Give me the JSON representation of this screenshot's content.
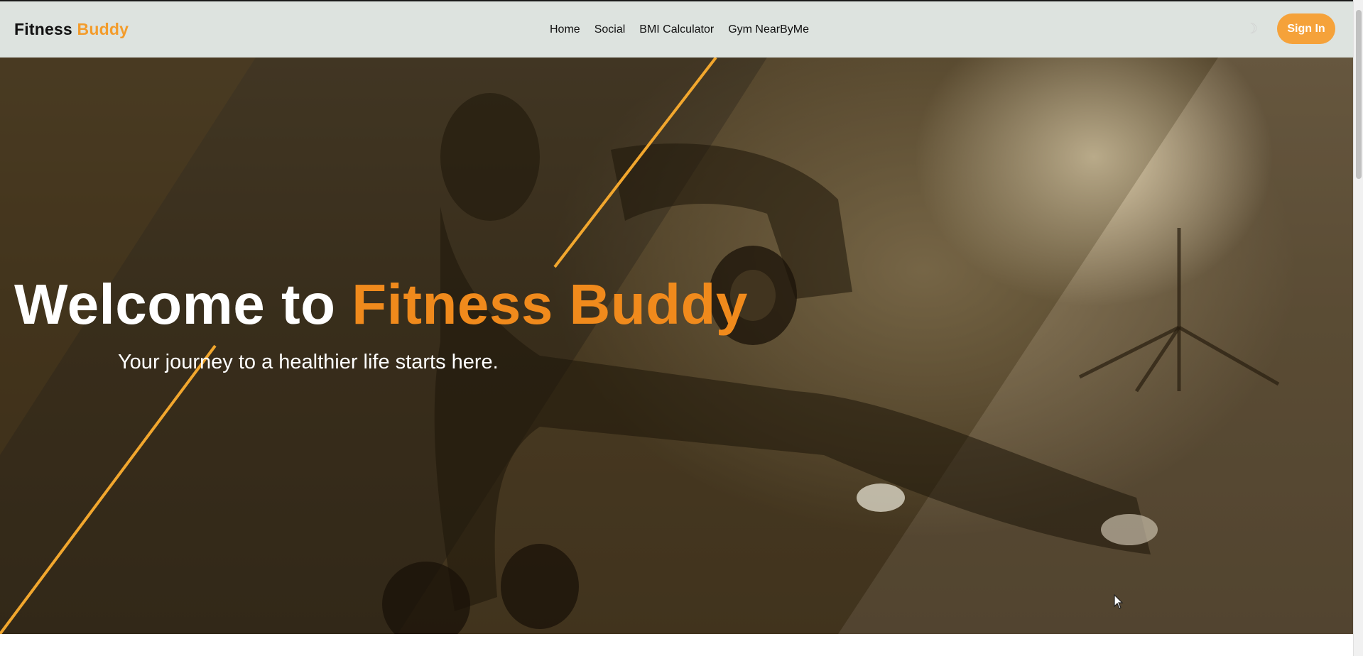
{
  "header": {
    "brand_primary": "Fitness",
    "brand_accent": "Buddy",
    "nav": [
      {
        "label": "Home"
      },
      {
        "label": "Social"
      },
      {
        "label": "BMI Calculator"
      },
      {
        "label": "Gym NearByMe"
      }
    ],
    "theme_toggle_glyph": "☽",
    "sign_in_label": "Sign In"
  },
  "hero": {
    "title_prefix": "Welcome to",
    "title_accent": "Fitness Buddy",
    "subtitle": "Your journey to a healthier life starts here.",
    "image_icon": "workout-photo"
  },
  "colors": {
    "accent": "#f39c2b",
    "title_accent": "#f08a1c",
    "navbar_bg": "#dde3df",
    "sign_in_bg": "#f5a23a",
    "stripe": "#f2a72e"
  }
}
